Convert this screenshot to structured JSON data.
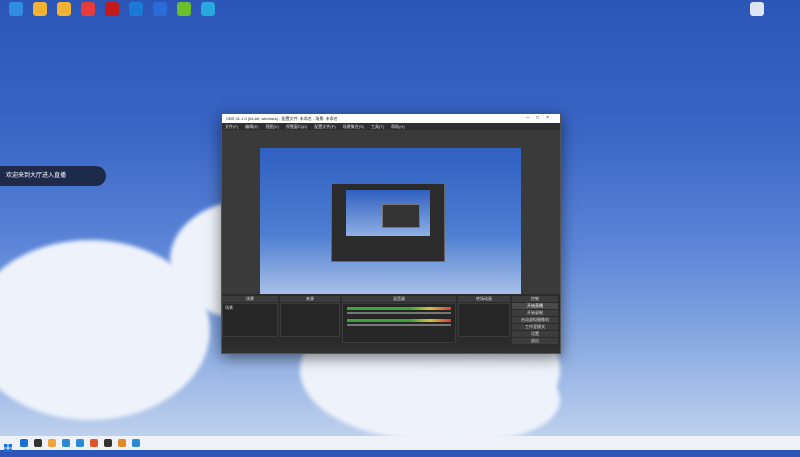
{
  "desktop": {
    "icons": [
      {
        "label": "",
        "color": "#2f8ce0"
      },
      {
        "label": "",
        "color": "#f2b233"
      },
      {
        "label": "",
        "color": "#f2b233"
      },
      {
        "label": "",
        "color": "#e63c3c"
      },
      {
        "label": "",
        "color": "#c51a1a"
      },
      {
        "label": "",
        "color": "#1c7ad6"
      },
      {
        "label": "",
        "color": "#2a6bd8"
      },
      {
        "label": "",
        "color": "#6bbf2a"
      },
      {
        "label": "",
        "color": "#29a8e0"
      }
    ],
    "recycle_bin_label": ""
  },
  "notification": {
    "prefix": "欢迎",
    "highlight": "",
    "suffix": "来到大厅进入直播"
  },
  "obs": {
    "title": "OBS 31.1.0 (64-bit, windows) - 配置文件: 未命名 - 场景: 未命名",
    "menu": [
      "文件(F)",
      "编辑(E)",
      "视图(V)",
      "停靠窗口(D)",
      "配置文件(P)",
      "场景集合(S)",
      "工具(T)",
      "帮助(H)"
    ],
    "docks": {
      "scenes": "场景",
      "sources": "来源",
      "mixer": "混音器",
      "transitions": "转场动画",
      "controls": "控制"
    },
    "scene_items": [
      "场景"
    ],
    "source_items": [
      "",
      "",
      "",
      ""
    ],
    "mixer_channels": [
      {
        "name": "",
        "value": ""
      },
      {
        "name": "",
        "value": ""
      }
    ],
    "controls": [
      "开始直播",
      "开始录制",
      "启动虚拟摄像机",
      "工作室模式",
      "设置",
      "退出"
    ],
    "status": ""
  },
  "taskbar": {
    "icons": [
      "#1a6fd6",
      "#333333",
      "#f2a23a",
      "#2a8ad8",
      "#2a8ad8",
      "#e0542a",
      "#333333",
      "#e08a2a",
      "#2a8ad8"
    ],
    "time": "",
    "date": ""
  }
}
